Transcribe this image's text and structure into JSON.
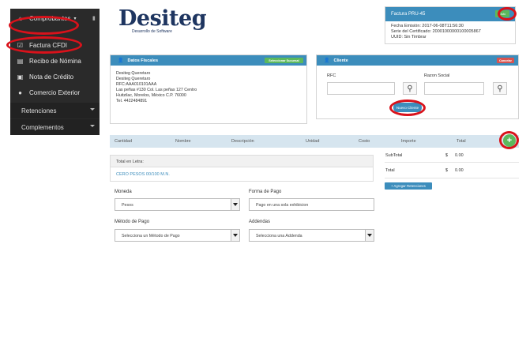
{
  "sidebar": {
    "header_label": "Comprobantes",
    "items": [
      {
        "label": "Factura CFDI",
        "icon": "document-edit-icon"
      },
      {
        "label": "Recibo de Nómina",
        "icon": "document-icon"
      },
      {
        "label": "Nota de Crédito",
        "icon": "note-icon"
      },
      {
        "label": "Comercio Exterior",
        "icon": "globe-icon"
      }
    ],
    "submenus": [
      {
        "label": "Retenciones"
      },
      {
        "label": "Complementos"
      }
    ]
  },
  "logo": {
    "name": "Desiteg",
    "tagline": "Desarrollo de Software",
    "color": "#1e3560"
  },
  "factura": {
    "title": "Factura PRU-45",
    "listo_label": "Listo",
    "fecha_emision": "Fecha Emisión: 2017-06-08T11:56:30",
    "serie_certificado": "Serie del Certificado: 20001000000100005867",
    "uuid": "UUID: Sin Timbrar"
  },
  "datos_fiscales": {
    "title": "Datos Fiscales",
    "select_button": "Seleccionar Sucursal",
    "lines": [
      "Desiteg Queretaro",
      "Desiteg Queretaro",
      "RFC:AAA010101AAA",
      "Las peñas #130 Col. Las peñas 127 Centro",
      "Huitzilac, Morelos, México C.P. 76000",
      "Tel. 4422484891"
    ]
  },
  "cliente": {
    "title": "Cliente",
    "cancel_button": "Cancelar",
    "rfc_label": "RFC",
    "razon_label": "Razon Social",
    "nuevo_label": "Nuevo Cliente"
  },
  "table": {
    "headers": [
      "Cantidad",
      "Nombre",
      "Descripción",
      "Unidad",
      "Costo",
      "Importe",
      "Total"
    ]
  },
  "total_letra": {
    "label": "Total en Letra:",
    "value": "CERO PESOS 00/100 M.N."
  },
  "totals": {
    "subtotal_label": "SubTotal",
    "subtotal_currency": "$",
    "subtotal_value": "0.00",
    "total_label": "Total",
    "total_currency": "$",
    "total_value": "0.00",
    "retenciones_label": "+ Agregar Retenciones"
  },
  "form": {
    "moneda_label": "Moneda",
    "moneda_value": "Pesos",
    "forma_pago_label": "Forma de Pago",
    "forma_pago_value": "Pago en una sola exhibicion",
    "metodo_label": "Método de Pago",
    "metodo_value": "Selecciona un Método de Pago",
    "addenda_label": "Addendas",
    "addenda_value": "Selecciona una Addenda"
  },
  "colors": {
    "primary": "#3c8dbc",
    "success": "#5cb85c",
    "danger": "#d9534f",
    "sidebar": "#2a2a2a",
    "highlight": "#d9121b"
  }
}
